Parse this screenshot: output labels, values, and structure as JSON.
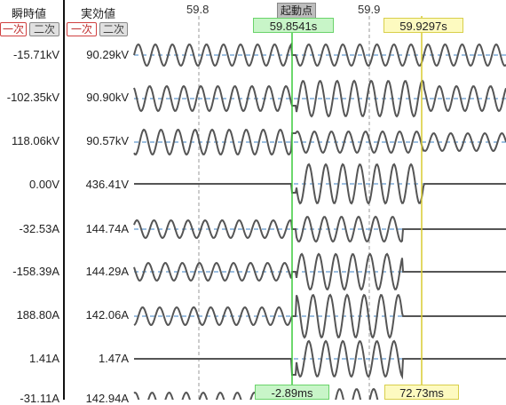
{
  "header": {
    "instant_label": "瞬時値",
    "rms_label": "実効値",
    "primary_label": "一次",
    "secondary_label": "二次"
  },
  "time_axis": {
    "tick1": "59.8",
    "tick2": "59.9"
  },
  "trigger_label": "起動点",
  "cursor_green": {
    "time": "59.8541s",
    "delta": "-2.89ms"
  },
  "cursor_yellow": {
    "time": "59.9297s",
    "delta": "72.73ms"
  },
  "channels": [
    {
      "inst": "-15.71kV",
      "rms": "90.29kV"
    },
    {
      "inst": "-102.35kV",
      "rms": "90.90kV"
    },
    {
      "inst": "118.06kV",
      "rms": "90.57kV"
    },
    {
      "inst": "0.00V",
      "rms": "436.41V"
    },
    {
      "inst": "-32.53A",
      "rms": "144.74A"
    },
    {
      "inst": "-158.39A",
      "rms": "144.29A"
    },
    {
      "inst": "188.80A",
      "rms": "142.06A"
    },
    {
      "inst": "1.41A",
      "rms": "1.47A"
    },
    {
      "inst": "-31.11A",
      "rms": "142.94A"
    }
  ],
  "colors": {
    "trace": "#555555",
    "baseline": "#3b82c4",
    "green_cursor": "#3ccc3c",
    "yellow_cursor": "#d8cc30"
  }
}
